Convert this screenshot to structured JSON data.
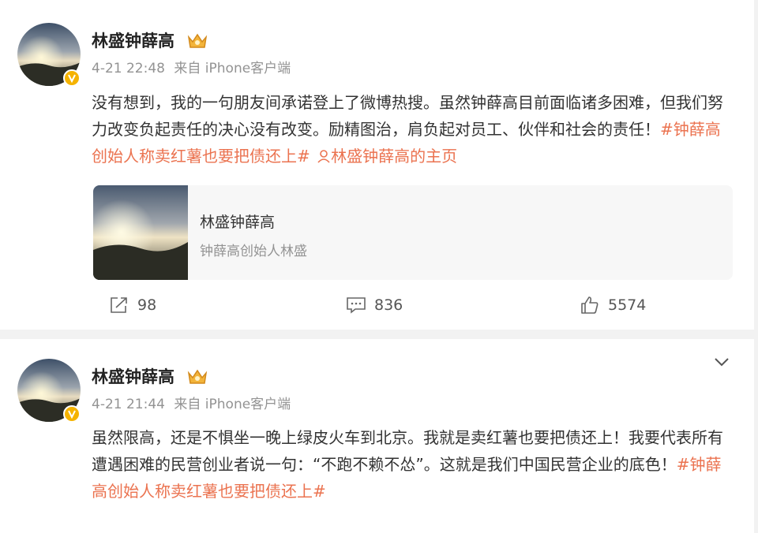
{
  "posts": [
    {
      "username": "林盛钟薛高",
      "timestamp": "4-21 22:48",
      "source": "来自 iPhone客户端",
      "body_text": "没有想到，我的一句朋友间承诺登上了微博热搜。虽然钟薛高目前面临诸多困难，但我们努力改变负起责任的决心没有改变。励精图治，肩负起对员工、伙伴和社会的责任！",
      "hashtag": "#钟薛高创始人称卖红薯也要把债还上#",
      "profile_link": "林盛钟薛高的主页",
      "link_card": {
        "title": "林盛钟薛高",
        "subtitle": "钟薛高创始人林盛"
      },
      "actions": {
        "share": "98",
        "comment": "836",
        "like": "5574"
      }
    },
    {
      "username": "林盛钟薛高",
      "timestamp": "4-21 21:44",
      "source": "来自 iPhone客户端",
      "body_text": "虽然限高，还是不惧坐一晚上绿皮火车到北京。我就是卖红薯也要把债还上！我要代表所有遭遇困难的民营创业者说一句：“不跑不赖不怂”。这就是我们中国民营企业的底色！",
      "hashtag": "#钟薛高创始人称卖红薯也要把债还上#"
    }
  ],
  "colors": {
    "accent": "#eb7350",
    "verified": "#f5b300",
    "muted": "#939393",
    "divider": "#f2f2f2"
  },
  "icons": [
    "share-icon",
    "comment-icon",
    "like-icon",
    "verified-badge-icon",
    "crown-icon",
    "person-icon",
    "chevron-down-icon"
  ]
}
